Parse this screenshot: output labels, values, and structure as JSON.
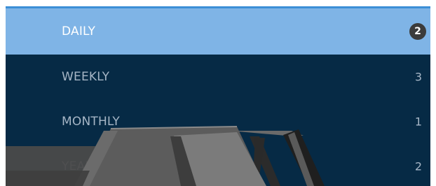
{
  "menu": {
    "items": [
      {
        "label": "DAILY",
        "count": "2",
        "active": true
      },
      {
        "label": "WEEKLY",
        "count": "3",
        "active": false
      },
      {
        "label": "MONTHLY",
        "count": "1",
        "active": false
      },
      {
        "label": "YEARLY",
        "count": "2",
        "active": false
      }
    ]
  },
  "colors": {
    "panel_background": "#062a45",
    "active_background": "#7fb4e6",
    "accent_line": "#3c8fd6",
    "badge_background": "#3b3b3b",
    "text_inactive": "#a6b6c6",
    "text_active": "#ffffff"
  },
  "decoration": {
    "icon": "roof-truss-graphic"
  }
}
